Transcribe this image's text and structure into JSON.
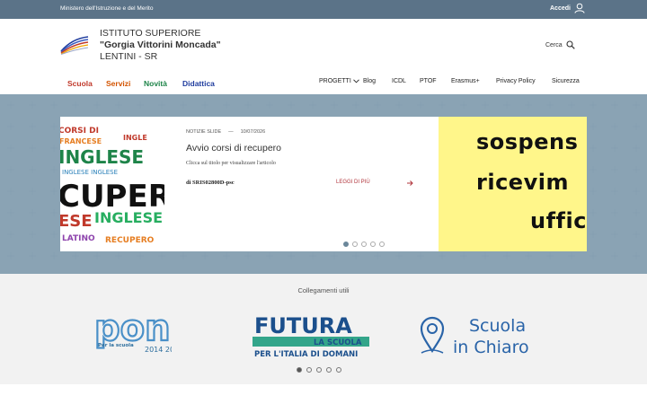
{
  "topbar": {
    "ministry": "Ministero dell'Istruzione e del Merito",
    "login": "Accedi"
  },
  "header": {
    "line1": "ISTITUTO SUPERIORE",
    "line2": "\"Gorgia Vittorini Moncada\"",
    "line3": "LENTINI - SR",
    "search": "Cerca"
  },
  "mainnav": [
    {
      "label": "Scuola",
      "color": "#c0392b"
    },
    {
      "label": "Servizi",
      "color": "#d35400"
    },
    {
      "label": "Novità",
      "color": "#1e8449"
    },
    {
      "label": "Didattica",
      "color": "#1f3c9e"
    }
  ],
  "subnav": [
    "PROGETTI",
    "Blog",
    "ICDL",
    "PTOF",
    "Erasmus+",
    "Privacy Policy",
    "Sicurezza"
  ],
  "slide": {
    "category": "NOTIZIE SLIDE",
    "separator": "—",
    "date": "10/07/2026",
    "title": "Avvio corsi di recupero",
    "description": "Clicca sul titolo per visualizzare l'articolo",
    "author": "di SRIS02800D-psc",
    "readmore": "LEGGI DI PIÙ",
    "image_words": [
      "CORSI DI RECUPERO",
      "INGLESE",
      "FRANCESE",
      "LATINO",
      "CUPERO",
      "INGLESE",
      "ESE"
    ],
    "yellow_lines": [
      "sospens",
      "ricevim",
      "uffic"
    ]
  },
  "slider_dots": 5,
  "links": {
    "title": "Collegamenti utili",
    "pon": {
      "big": "pon",
      "small": "Per la scuola",
      "years": "2014 2020"
    },
    "futura": {
      "title": "FUTURA",
      "sub1": "LA SCUOLA",
      "sub2": "PER L'ITALIA DI DOMANI"
    },
    "chiaro": {
      "line1": "Scuola",
      "line2": "in Chiaro"
    },
    "dots": 5
  },
  "colors": {
    "topbar": "#5b7388",
    "hero": "#5a7a90",
    "yellow": "#fff68a",
    "accent": "#b0333a"
  }
}
